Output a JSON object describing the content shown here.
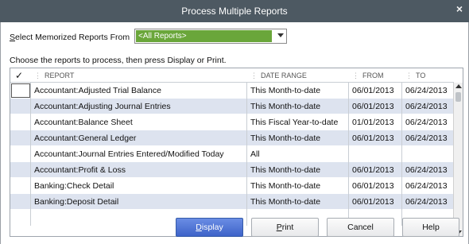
{
  "window": {
    "title": "Process Multiple Reports",
    "close_glyph": "×"
  },
  "filter": {
    "label_prefix": "S",
    "label_rest": "elect Memorized Reports From",
    "value": "<All Reports>"
  },
  "instructions": "Choose the reports to process, then press Display or Print.",
  "table": {
    "check_header": "✓",
    "columns": [
      "REPORT",
      "DATE RANGE",
      "FROM",
      "TO"
    ],
    "rows": [
      {
        "report": "Accountant:Adjusted Trial Balance",
        "range": "This Month-to-date",
        "from": "06/01/2013",
        "to": "06/24/2013"
      },
      {
        "report": "Accountant:Adjusting Journal Entries",
        "range": "This Month-to-date",
        "from": "06/01/2013",
        "to": "06/24/2013"
      },
      {
        "report": "Accountant:Balance Sheet",
        "range": "This Fiscal Year-to-date",
        "from": "01/01/2013",
        "to": "06/24/2013"
      },
      {
        "report": "Accountant:General Ledger",
        "range": "This Month-to-date",
        "from": "06/01/2013",
        "to": "06/24/2013"
      },
      {
        "report": "Accountant:Journal Entries Entered/Modified Today",
        "range": "All",
        "from": "",
        "to": ""
      },
      {
        "report": "Accountant:Profit & Loss",
        "range": "This Month-to-date",
        "from": "06/01/2013",
        "to": "06/24/2013"
      },
      {
        "report": "Banking:Check Detail",
        "range": "This Month-to-date",
        "from": "06/01/2013",
        "to": "06/24/2013"
      },
      {
        "report": "Banking:Deposit Detail",
        "range": "This Month-to-date",
        "from": "06/01/2013",
        "to": "06/24/2013"
      },
      {
        "report": "",
        "range": "",
        "from": "",
        "to": ""
      }
    ]
  },
  "buttons": {
    "display": {
      "underline": "D",
      "rest": "isplay"
    },
    "print": {
      "underline": "P",
      "rest": "rint"
    },
    "cancel": "Cancel",
    "help": "Help"
  },
  "colors": {
    "titlebar": "#4d5962",
    "filter_value_bg": "#6aa63a",
    "row_shade": "#dde3ef",
    "primary_button": "#3e63c9"
  }
}
